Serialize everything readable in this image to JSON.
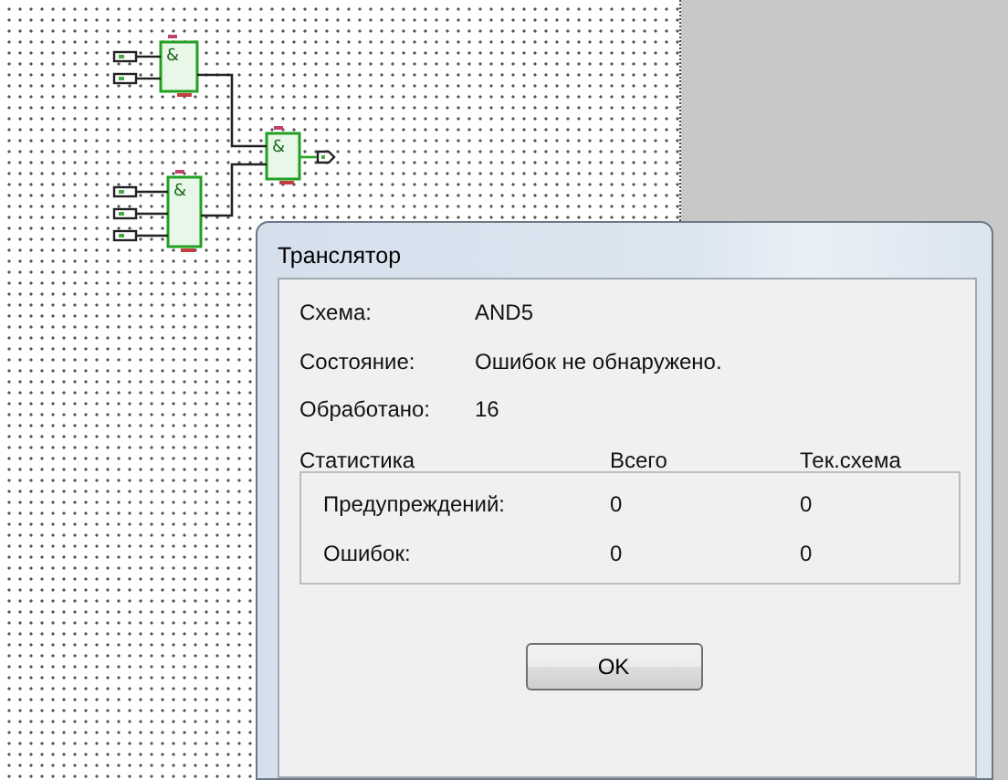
{
  "circuit": {
    "gates": [
      {
        "symbol": "&"
      },
      {
        "symbol": "&"
      },
      {
        "symbol": "&"
      }
    ]
  },
  "window": {
    "title": "Транслятор"
  },
  "fields": [
    {
      "label": "Схема:",
      "value": "AND5"
    },
    {
      "label": "Состояние:",
      "value": "Ошибок не обнаружено."
    },
    {
      "label": "Обработано:",
      "value": "16"
    }
  ],
  "statistics": {
    "columns": [
      "Статистика",
      "Всего",
      "Тек.схема"
    ],
    "rows": [
      {
        "label": "Предупреждений:",
        "total": "0",
        "current": "0"
      },
      {
        "label": "Ошибок:",
        "total": "0",
        "current": "0"
      }
    ]
  },
  "buttons": [
    "OK"
  ]
}
